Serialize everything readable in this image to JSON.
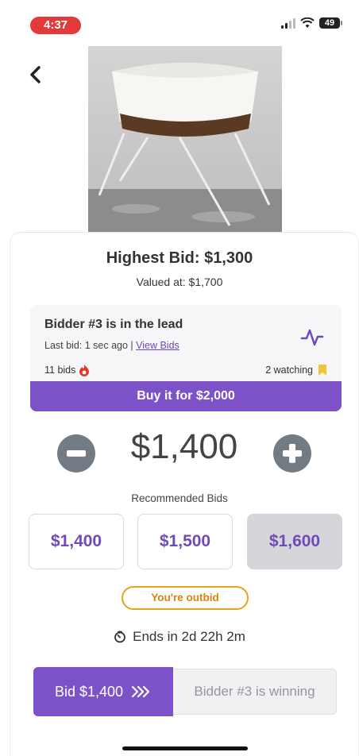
{
  "status": {
    "time": "4:37",
    "battery": "49"
  },
  "product": {
    "image_icon": "bassinet-photo"
  },
  "bid": {
    "highest_label": "Highest Bid: $1,300",
    "valued_label": "Valued at: $1,700",
    "lead_title": "Bidder #3 is in the lead",
    "last_bid_prefix": "Last bid: 1 sec ago | ",
    "view_bids_link": "View Bids",
    "bid_count": "11 bids",
    "watching": "2 watching",
    "buy_now": "Buy it for $2,000",
    "current_amount": "$1,400",
    "recommended_label": "Recommended Bids",
    "recommended": [
      "$1,400",
      "$1,500",
      "$1,600"
    ],
    "outbid_badge": "You're outbid",
    "ends_in": "Ends in 2d 22h 2m",
    "bid_button": "Bid $1,400",
    "winning_status": "Bidder #3 is winning"
  },
  "colors": {
    "accent": "#7d52c9",
    "outbid": "#e8a31c",
    "time_pill": "#e23a3a"
  }
}
